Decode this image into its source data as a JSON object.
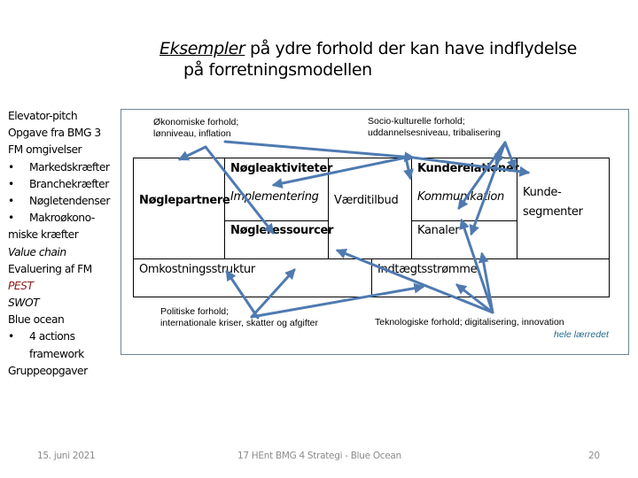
{
  "title": {
    "emphasis": "Eksempler",
    "line1_rest": " på ydre forhold der kan have indflydelse",
    "line2": "på forretningsmodellen"
  },
  "sidebar": {
    "items": [
      {
        "text": "Elevator-pitch",
        "style": "normal"
      },
      {
        "text": "Opgave fra BMG 3",
        "style": "normal"
      },
      {
        "text": "FM omgivelser",
        "style": "normal"
      },
      {
        "text": "Markedskræfter",
        "style": "bullet"
      },
      {
        "text": "Branchekræfter",
        "style": "bullet"
      },
      {
        "text": "Nøgletendenser",
        "style": "bullet"
      },
      {
        "text": "Makroøkono-",
        "style": "bullet"
      },
      {
        "text": "miske kræfter",
        "style": "normal"
      },
      {
        "text": "Value chain",
        "style": "italic"
      },
      {
        "text": "Evaluering af FM",
        "style": "normal"
      },
      {
        "text": "PEST",
        "style": "italic-red"
      },
      {
        "text": "SWOT",
        "style": "italic"
      },
      {
        "text": "Blue ocean",
        "style": "normal"
      },
      {
        "text": "4 actions",
        "style": "bullet"
      },
      {
        "text": "framework",
        "style": "indent"
      },
      {
        "text": "Gruppeopgaver",
        "style": "normal"
      }
    ],
    "bullet_glyph": "•",
    "accent_color": "#8b1a1a"
  },
  "canvas": {
    "key_partners": "Nøglepartnere",
    "key_activities": "Nøgleaktiviteter",
    "implementation": "Implementering",
    "key_resources": "Nøgleressourcer",
    "value_proposition": "Værditilbud",
    "customer_relations": "Kunderelationer",
    "communication": "Kommunikation",
    "channels": "Kanaler",
    "customer_segments_1": "Kunde-",
    "customer_segments_2": "segmenter",
    "cost_structure": "Omkostningsstruktur",
    "revenue_streams": "Indtægtsstrømme"
  },
  "notes": {
    "economic_1": "Økonomiske forhold;",
    "economic_2": "lønniveau, inflation",
    "sociocultural_1": "Socio-kulturelle forhold;",
    "sociocultural_2": "uddannelsesniveau, tribalisering",
    "political_1": "Politiske forhold;",
    "political_2": "internationale kriser, skatter og afgifter",
    "technological": "Teknologiske forhold; digitalisering, innovation",
    "whole_canvas": "hele lærredet"
  },
  "colors": {
    "arrow": "#4f7ab0",
    "frame_border": "#6d8594",
    "note_accent": "#1f6b8b",
    "footer_text": "#8c8c8c"
  },
  "footer": {
    "date": "15. juni 2021",
    "course": "17 HEnt  BMG 4 Strategi - Blue Ocean",
    "page_number": "20"
  }
}
